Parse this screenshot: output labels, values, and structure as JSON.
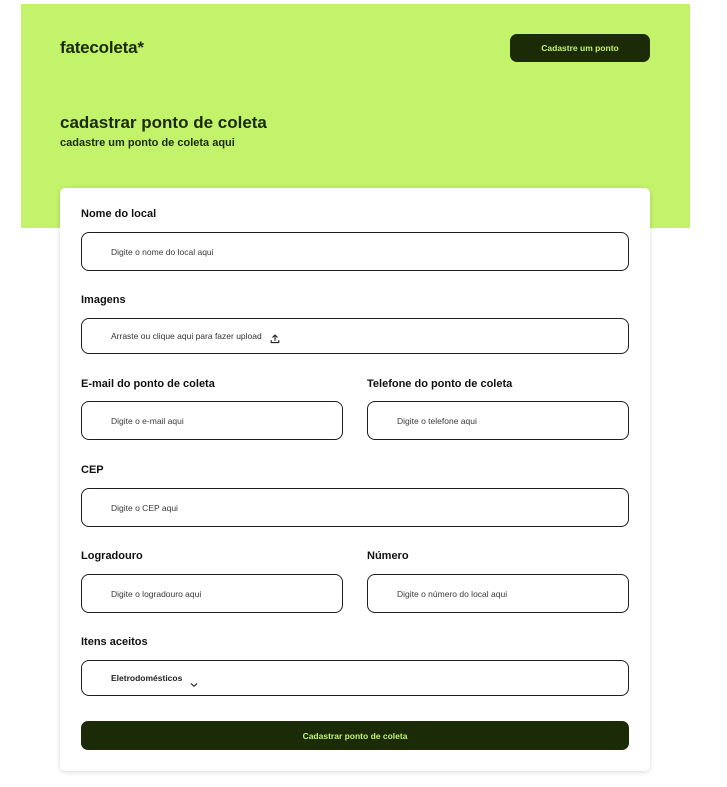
{
  "brand": {
    "logo": "fatecoleta*"
  },
  "header": {
    "cta_label": "Cadastre um ponto"
  },
  "hero": {
    "title": "cadastrar ponto de coleta",
    "subtitle": "cadastre um ponto de coleta aqui"
  },
  "form": {
    "name": {
      "label": "Nome do local",
      "placeholder": "Digite o nome do local aqui"
    },
    "images": {
      "label": "Imagens",
      "upload_text": "Arraste ou clique aqui para fazer upload",
      "icon": "upload-icon"
    },
    "email": {
      "label": "E-mail do ponto de coleta",
      "placeholder": "Digite o e-mail aqui"
    },
    "phone": {
      "label": "Telefone do ponto de coleta",
      "placeholder": "Digite o telefone aqui"
    },
    "cep": {
      "label": "CEP",
      "placeholder": "Digite o CEP aqui"
    },
    "street": {
      "label": "Logradouro",
      "placeholder": "Digite o logradouro aqui"
    },
    "number": {
      "label": "Número",
      "placeholder": "Digite o número do local aqui"
    },
    "items": {
      "label": "Itens aceitos",
      "selected": "Eletrodomésticos",
      "icon": "chevron-down-icon"
    },
    "submit_label": "Cadastrar ponto de coleta"
  },
  "colors": {
    "accent": "#c3f36b",
    "dark": "#1b2b08",
    "border": "#1f1f1f"
  }
}
